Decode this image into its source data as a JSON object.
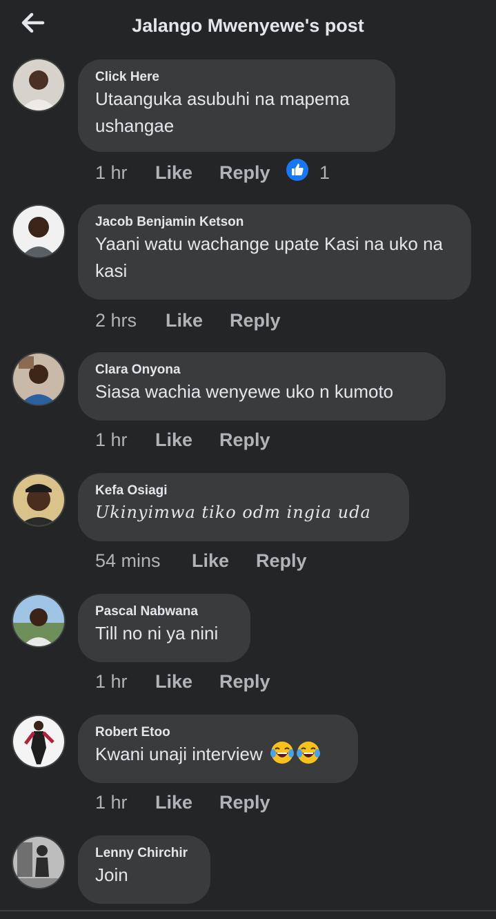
{
  "header": {
    "title": "Jalango Mwenyewe's post",
    "back_icon": "arrow-left-icon"
  },
  "comments": [
    {
      "name": "Click Here",
      "text": "Utaanguka asubuhi na mapema ushangae",
      "time": "1 hr",
      "like": "Like",
      "reply": "Reply",
      "reaction_icon": "like-reaction-icon",
      "reaction_count": "1"
    },
    {
      "name": "Jacob Benjamin Ketson",
      "text": "Yaani watu wachange upate Kasi na uko na kasi",
      "time": "2 hrs",
      "like": "Like",
      "reply": "Reply"
    },
    {
      "name": "Clara Onyona",
      "text": "Siasa wachia wenyewe uko n kumoto",
      "time": "1 hr",
      "like": "Like",
      "reply": "Reply"
    },
    {
      "name": "Kefa Osiagi",
      "text": "Ukinyimwa tiko odm ingia uda",
      "time": "54 mins",
      "like": "Like",
      "reply": "Reply"
    },
    {
      "name": "Pascal Nabwana",
      "text": "Till no ni ya nini",
      "time": "1 hr",
      "like": "Like",
      "reply": "Reply"
    },
    {
      "name": "Robert Etoo",
      "text": "Kwani unaji interview",
      "emoji": "face-with-tears-of-joy-icon",
      "time": "1 hr",
      "like": "Like",
      "reply": "Reply"
    },
    {
      "name": "Lenny Chirchir",
      "text": "Join"
    }
  ],
  "colors": {
    "background": "#242526",
    "bubble": "#3a3b3c",
    "text": "#e4e6eb",
    "secondary": "#b0b3b8",
    "like_blue": "#1877f2"
  }
}
